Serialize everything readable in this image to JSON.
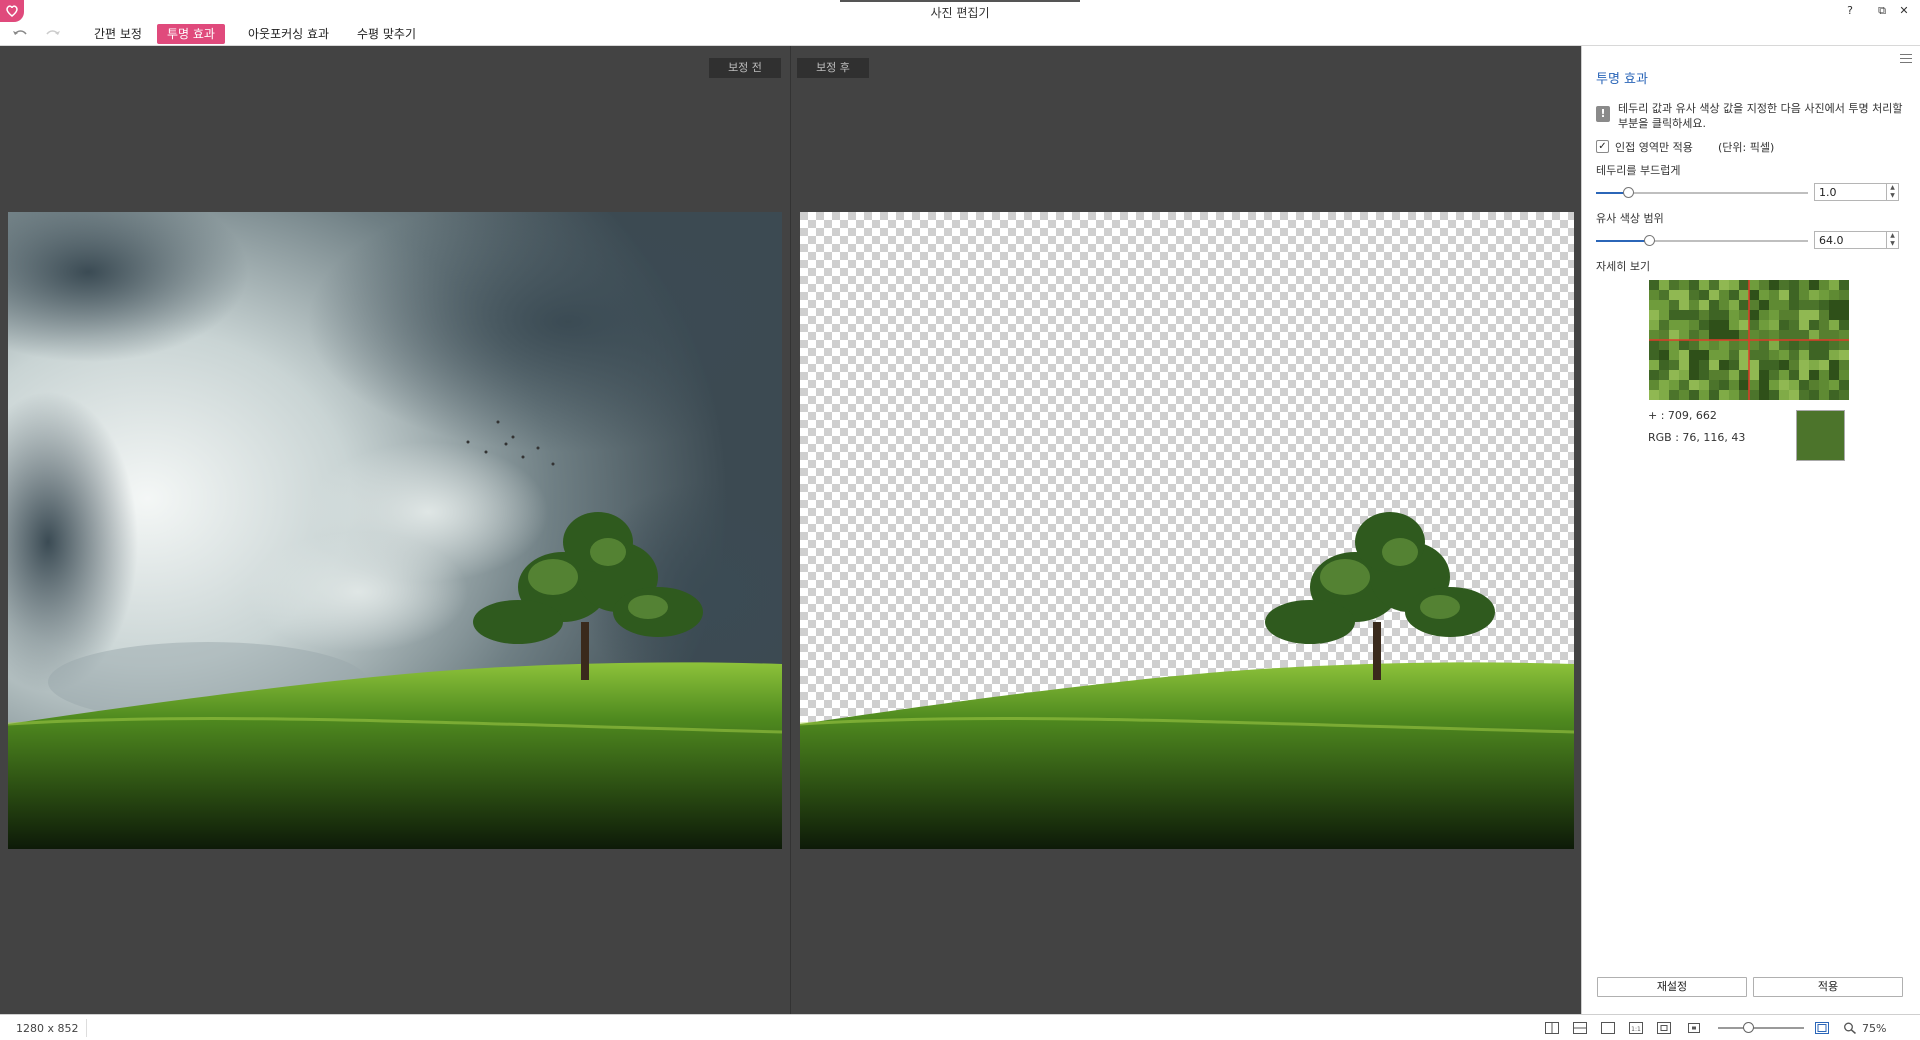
{
  "window": {
    "title": "사진 편집기",
    "help": "?",
    "restore": "⧉",
    "close": "✕"
  },
  "toolbar": {
    "tabs": [
      {
        "label": "간편 보정",
        "active": false
      },
      {
        "label": "투명 효과",
        "active": true
      },
      {
        "label": "아웃포커싱 효과",
        "active": false
      },
      {
        "label": "수평 맞추기",
        "active": false
      }
    ]
  },
  "canvas": {
    "before_label": "보정 전",
    "after_label": "보정 후"
  },
  "panel": {
    "title": "투명 효과",
    "info_text": "테두리 값과 유사 색상 값을 지정한 다음 사진에서 투명 처리할 부분을 클릭하세요.",
    "adjacent_only": {
      "label": "인접 영역만 적용",
      "checked": true,
      "check_mark": "✓"
    },
    "unit_label": "(단위: 픽셀)",
    "soften_edge": {
      "label": "테두리를 부드럽게",
      "value": "1.0",
      "level": 0.15
    },
    "color_range": {
      "label": "유사 색상 범위",
      "value": "64.0",
      "level": 0.25
    },
    "detail_view_label": "자세히 보기",
    "coord_symbol": "+",
    "coord_text": ": 709, 662",
    "rgb_label": "RGB",
    "rgb_text": ": 76, 116, 43",
    "sample_color": "#4c742b",
    "reset_button": "재설정",
    "apply_button": "적용"
  },
  "status": {
    "dimensions": "1280 x 852",
    "zoom": "75%",
    "zoom_level": 0.35
  },
  "colors": {
    "accent": "#e04a7c",
    "panel_title": "#2b66b8",
    "canvas_bg": "#434343"
  }
}
